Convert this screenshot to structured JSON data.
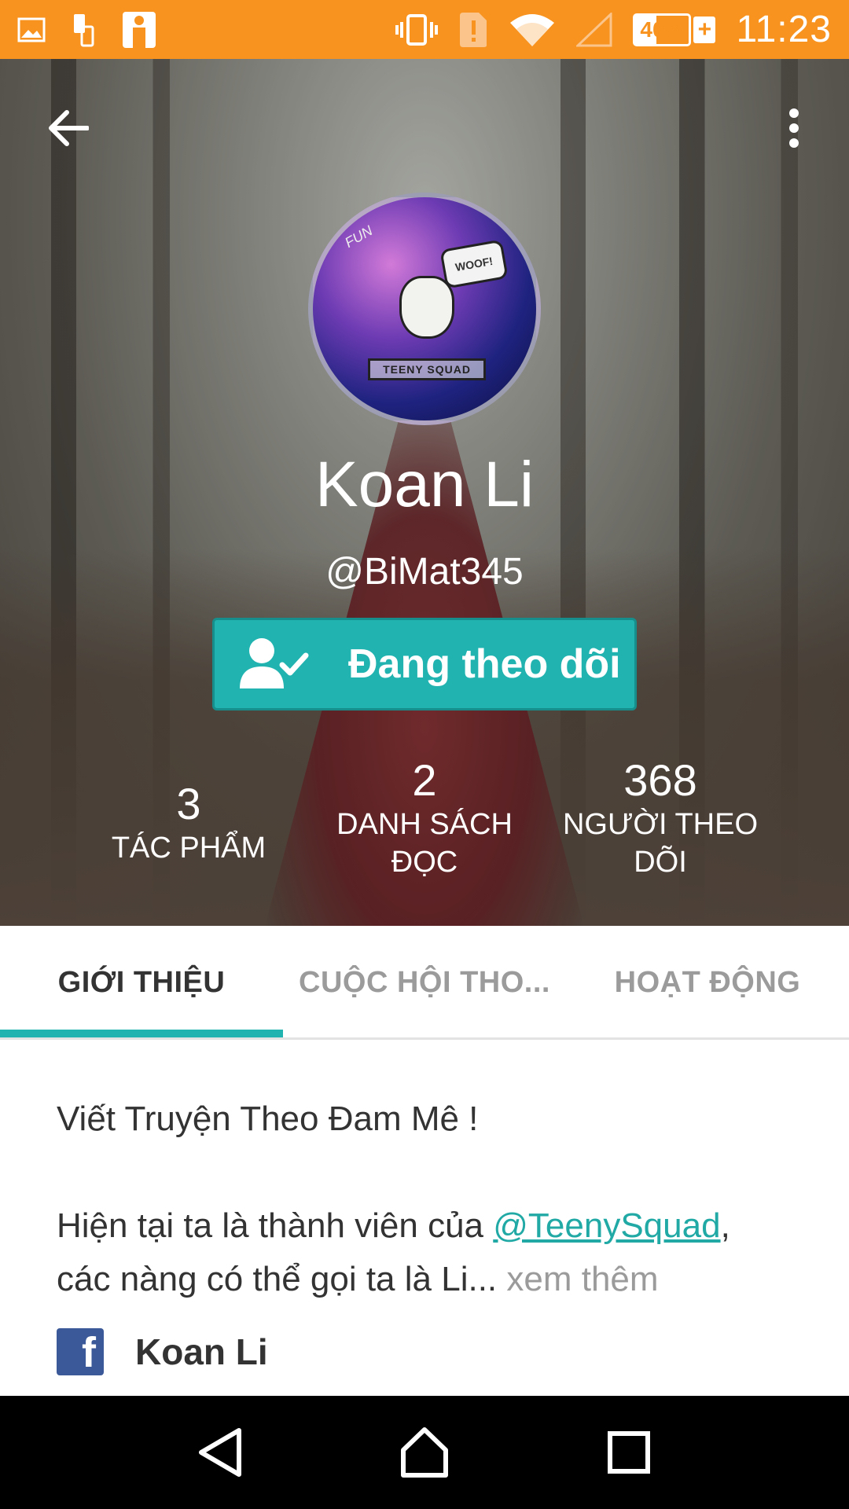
{
  "status_bar": {
    "battery": "40%",
    "time": "11:23",
    "icons": [
      "image-icon",
      "phone-device-icon",
      "app-icon",
      "vibrate-icon",
      "alert-icon",
      "wifi-icon",
      "no-signal-icon",
      "battery-icon"
    ]
  },
  "profile": {
    "name": "Koan Li",
    "handle": "@BiMat345",
    "follow_button": "Đang theo dõi",
    "avatar_text": {
      "bubble": "WOOF!",
      "banner": "TEENY SQUAD",
      "scribble": "FUN"
    }
  },
  "stats": [
    {
      "value": "3",
      "label_line1": "TÁC PHẨM",
      "label_line2": ""
    },
    {
      "value": "2",
      "label_line1": "DANH SÁCH",
      "label_line2": "ĐỌC"
    },
    {
      "value": "368",
      "label_line1": "NGƯỜI THEO",
      "label_line2": "DÕI"
    }
  ],
  "tabs": [
    {
      "label": "GIỚI THIỆU",
      "active": true
    },
    {
      "label": "CUỘC HỘI THO...",
      "active": false
    },
    {
      "label": "HOẠT ĐỘNG",
      "active": false
    }
  ],
  "about": {
    "line1": "Viết Truyện Theo Đam Mê !",
    "line2_prefix": "Hiện tại ta là thành viên của ",
    "mention": "@TeenySquad",
    "line2_suffix": ",",
    "line3": "các nàng có thể gọi ta là Li...",
    "see_more": " xem thêm",
    "facebook_name": "Koan Li"
  },
  "colors": {
    "status_bar": "#f7931e",
    "accent": "#21b3b0",
    "facebook": "#3b5998"
  }
}
